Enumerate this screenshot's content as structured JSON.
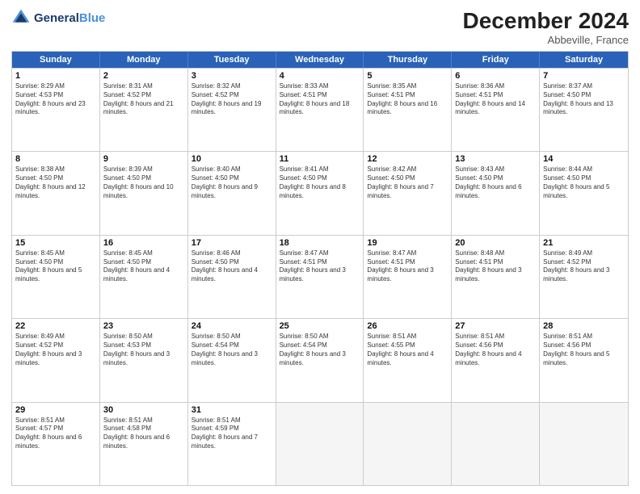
{
  "header": {
    "logo_line1": "General",
    "logo_line2": "Blue",
    "month": "December 2024",
    "location": "Abbeville, France"
  },
  "days_of_week": [
    "Sunday",
    "Monday",
    "Tuesday",
    "Wednesday",
    "Thursday",
    "Friday",
    "Saturday"
  ],
  "weeks": [
    [
      {
        "day": 1,
        "sunrise": "8:29 AM",
        "sunset": "4:53 PM",
        "daylight": "8 hours and 23 minutes"
      },
      {
        "day": 2,
        "sunrise": "8:31 AM",
        "sunset": "4:52 PM",
        "daylight": "8 hours and 21 minutes"
      },
      {
        "day": 3,
        "sunrise": "8:32 AM",
        "sunset": "4:52 PM",
        "daylight": "8 hours and 19 minutes"
      },
      {
        "day": 4,
        "sunrise": "8:33 AM",
        "sunset": "4:51 PM",
        "daylight": "8 hours and 18 minutes"
      },
      {
        "day": 5,
        "sunrise": "8:35 AM",
        "sunset": "4:51 PM",
        "daylight": "8 hours and 16 minutes"
      },
      {
        "day": 6,
        "sunrise": "8:36 AM",
        "sunset": "4:51 PM",
        "daylight": "8 hours and 14 minutes"
      },
      {
        "day": 7,
        "sunrise": "8:37 AM",
        "sunset": "4:50 PM",
        "daylight": "8 hours and 13 minutes"
      }
    ],
    [
      {
        "day": 8,
        "sunrise": "8:38 AM",
        "sunset": "4:50 PM",
        "daylight": "8 hours and 12 minutes"
      },
      {
        "day": 9,
        "sunrise": "8:39 AM",
        "sunset": "4:50 PM",
        "daylight": "8 hours and 10 minutes"
      },
      {
        "day": 10,
        "sunrise": "8:40 AM",
        "sunset": "4:50 PM",
        "daylight": "8 hours and 9 minutes"
      },
      {
        "day": 11,
        "sunrise": "8:41 AM",
        "sunset": "4:50 PM",
        "daylight": "8 hours and 8 minutes"
      },
      {
        "day": 12,
        "sunrise": "8:42 AM",
        "sunset": "4:50 PM",
        "daylight": "8 hours and 7 minutes"
      },
      {
        "day": 13,
        "sunrise": "8:43 AM",
        "sunset": "4:50 PM",
        "daylight": "8 hours and 6 minutes"
      },
      {
        "day": 14,
        "sunrise": "8:44 AM",
        "sunset": "4:50 PM",
        "daylight": "8 hours and 5 minutes"
      }
    ],
    [
      {
        "day": 15,
        "sunrise": "8:45 AM",
        "sunset": "4:50 PM",
        "daylight": "8 hours and 5 minutes"
      },
      {
        "day": 16,
        "sunrise": "8:45 AM",
        "sunset": "4:50 PM",
        "daylight": "8 hours and 4 minutes"
      },
      {
        "day": 17,
        "sunrise": "8:46 AM",
        "sunset": "4:50 PM",
        "daylight": "8 hours and 4 minutes"
      },
      {
        "day": 18,
        "sunrise": "8:47 AM",
        "sunset": "4:51 PM",
        "daylight": "8 hours and 3 minutes"
      },
      {
        "day": 19,
        "sunrise": "8:47 AM",
        "sunset": "4:51 PM",
        "daylight": "8 hours and 3 minutes"
      },
      {
        "day": 20,
        "sunrise": "8:48 AM",
        "sunset": "4:51 PM",
        "daylight": "8 hours and 3 minutes"
      },
      {
        "day": 21,
        "sunrise": "8:49 AM",
        "sunset": "4:52 PM",
        "daylight": "8 hours and 3 minutes"
      }
    ],
    [
      {
        "day": 22,
        "sunrise": "8:49 AM",
        "sunset": "4:52 PM",
        "daylight": "8 hours and 3 minutes"
      },
      {
        "day": 23,
        "sunrise": "8:50 AM",
        "sunset": "4:53 PM",
        "daylight": "8 hours and 3 minutes"
      },
      {
        "day": 24,
        "sunrise": "8:50 AM",
        "sunset": "4:54 PM",
        "daylight": "8 hours and 3 minutes"
      },
      {
        "day": 25,
        "sunrise": "8:50 AM",
        "sunset": "4:54 PM",
        "daylight": "8 hours and 3 minutes"
      },
      {
        "day": 26,
        "sunrise": "8:51 AM",
        "sunset": "4:55 PM",
        "daylight": "8 hours and 4 minutes"
      },
      {
        "day": 27,
        "sunrise": "8:51 AM",
        "sunset": "4:56 PM",
        "daylight": "8 hours and 4 minutes"
      },
      {
        "day": 28,
        "sunrise": "8:51 AM",
        "sunset": "4:56 PM",
        "daylight": "8 hours and 5 minutes"
      }
    ],
    [
      {
        "day": 29,
        "sunrise": "8:51 AM",
        "sunset": "4:57 PM",
        "daylight": "8 hours and 6 minutes"
      },
      {
        "day": 30,
        "sunrise": "8:51 AM",
        "sunset": "4:58 PM",
        "daylight": "8 hours and 6 minutes"
      },
      {
        "day": 31,
        "sunrise": "8:51 AM",
        "sunset": "4:59 PM",
        "daylight": "8 hours and 7 minutes"
      },
      null,
      null,
      null,
      null
    ]
  ]
}
